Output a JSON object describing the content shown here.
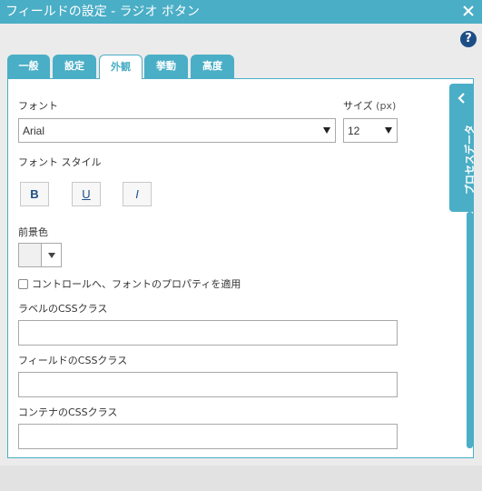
{
  "window": {
    "title": "フィールドの設定 - ラジオ ボタン"
  },
  "tabs": [
    {
      "label": "一般"
    },
    {
      "label": "設定"
    },
    {
      "label": "外観"
    },
    {
      "label": "挙動"
    },
    {
      "label": "高度"
    }
  ],
  "active_tab": "外観",
  "help": {
    "symbol": "?"
  },
  "font": {
    "label": "フォント",
    "value": "Arial"
  },
  "size": {
    "label": "サイズ",
    "unit": "(px)",
    "value": "12"
  },
  "font_style": {
    "label": "フォント スタイル",
    "bold": "B",
    "underline": "U",
    "italic": "I"
  },
  "foreground": {
    "label": "前景色"
  },
  "apply_checkbox": {
    "label": "コントロールへ、フォントのプロパティを適用",
    "checked": false
  },
  "label_css": {
    "label": "ラベルのCSSクラス",
    "value": ""
  },
  "field_css": {
    "label": "フィールドのCSSクラス",
    "value": ""
  },
  "container_css": {
    "label": "コンテナのCSSクラス",
    "value": ""
  },
  "side_panel": {
    "label": "プロセスデータ"
  },
  "colors": {
    "accent": "#4aaec6",
    "help": "#1c4e86",
    "background": "#ebebeb"
  }
}
